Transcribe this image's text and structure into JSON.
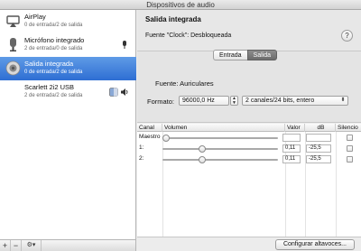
{
  "window": {
    "title": "Dispositivos de audio"
  },
  "sidebar": {
    "devices": [
      {
        "name": "AirPlay",
        "sub": "0 de entrada/2 de salida",
        "icon": "airplay-icon"
      },
      {
        "name": "Micrófono integrado",
        "sub": "2 de entrada/0 de salida",
        "icon": "microphone-icon"
      },
      {
        "name": "Salida integrada",
        "sub": "0 de entrada/2 de salida",
        "icon": "speaker-icon"
      },
      {
        "name": "Scarlett 2i2 USB",
        "sub": "2 de entrada/2 de salida",
        "icon": "usb-audio-icon"
      }
    ],
    "toolbar": {
      "add": "+",
      "remove": "−",
      "gear": "⚙▾"
    }
  },
  "main": {
    "title": "Salida integrada",
    "source": "Fuente \"Clock\":  Desbloqueada",
    "help": "?",
    "tabs": [
      {
        "label": "Entrada"
      },
      {
        "label": "Salida"
      }
    ],
    "source_row": "Fuente:  Auriculares",
    "format_label": "Formato:",
    "format_rate": "96000,0 Hz",
    "format_channels": "2 canales/24 bits, entero",
    "table": {
      "headers": {
        "channel": "Canal",
        "volume": "Volumen",
        "value": "Valor",
        "db": "dB",
        "mute": "Silencio"
      },
      "rows": [
        {
          "label": "Maestro",
          "value": "",
          "db": "",
          "level": 0.0
        },
        {
          "label": "1:",
          "value": "0,11",
          "db": "-25,5",
          "level": 0.33
        },
        {
          "label": "2:",
          "value": "0,11",
          "db": "-25,5",
          "level": 0.33
        }
      ]
    },
    "configure_button": "Configurar altavoces..."
  },
  "colors": {
    "selection": "#3b7bd9",
    "active_tab": "#777777"
  }
}
